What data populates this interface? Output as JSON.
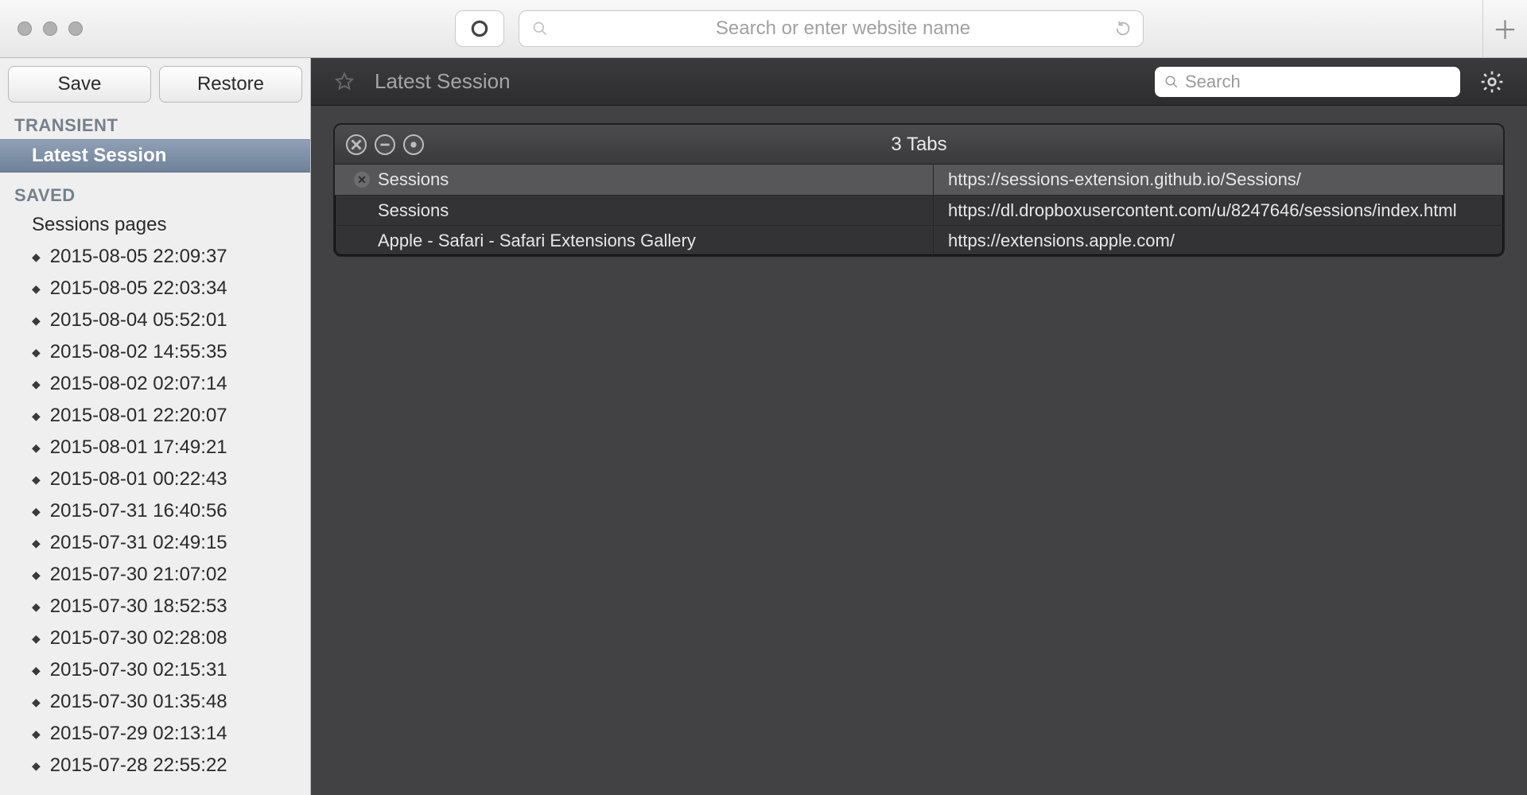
{
  "chrome": {
    "url_placeholder": "Search or enter website name"
  },
  "sidebar": {
    "save_label": "Save",
    "restore_label": "Restore",
    "section_transient": "TRANSIENT",
    "latest_session": "Latest Session",
    "section_saved": "SAVED",
    "sessions_pages": "Sessions pages",
    "saved_items": [
      "2015-08-05 22:09:37",
      "2015-08-05 22:03:34",
      "2015-08-04 05:52:01",
      "2015-08-02 14:55:35",
      "2015-08-02 02:07:14",
      "2015-08-01 22:20:07",
      "2015-08-01 17:49:21",
      "2015-08-01 00:22:43",
      "2015-07-31 16:40:56",
      "2015-07-31 02:49:15",
      "2015-07-30 21:07:02",
      "2015-07-30 18:52:53",
      "2015-07-30 02:28:08",
      "2015-07-30 02:15:31",
      "2015-07-30 01:35:48",
      "2015-07-29 02:13:14",
      "2015-07-28 22:55:22"
    ]
  },
  "content": {
    "title": "Latest Session",
    "search_placeholder": "Search",
    "tabs_count": "3 Tabs",
    "rows": [
      {
        "title": "Sessions",
        "url": "https://sessions-extension.github.io/Sessions/",
        "selected": true
      },
      {
        "title": "Sessions",
        "url": "https://dl.dropboxusercontent.com/u/8247646/sessions/index.html",
        "selected": false
      },
      {
        "title": "Apple - Safari - Safari Extensions Gallery",
        "url": "https://extensions.apple.com/",
        "selected": false
      }
    ]
  }
}
